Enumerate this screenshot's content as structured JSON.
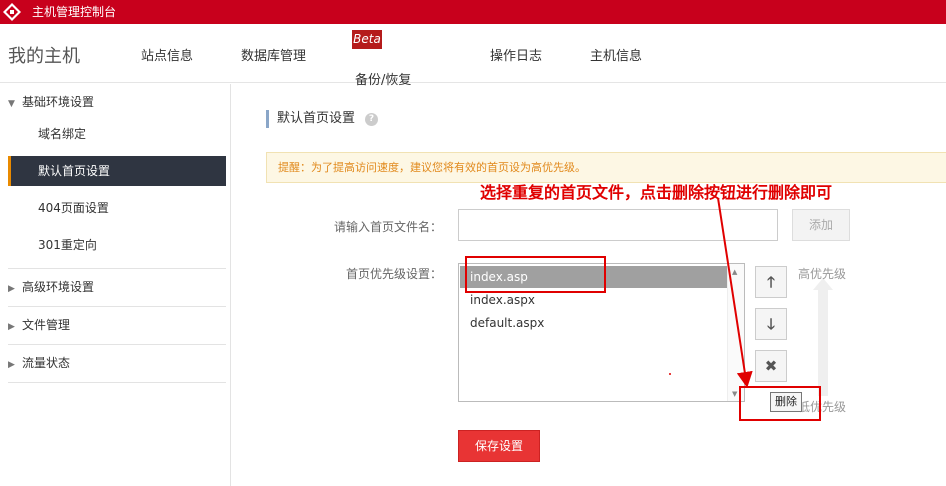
{
  "topbar": {
    "title": "主机管理控制台",
    "logo_icon": "logo-icon",
    "brand_color": "#c8001c"
  },
  "nav": {
    "brand": "我的主机",
    "items": [
      {
        "label": "站点信息"
      },
      {
        "label": "数据库管理"
      },
      {
        "label": "备份/恢复",
        "badge": "Beta"
      },
      {
        "label": "操作日志"
      },
      {
        "label": "主机信息"
      }
    ]
  },
  "sidebar": {
    "sections": [
      {
        "label": "基础环境设置",
        "expanded": true,
        "items": [
          {
            "label": "域名绑定"
          },
          {
            "label": "默认首页设置",
            "active": true
          },
          {
            "label": "404页面设置"
          },
          {
            "label": "301重定向"
          }
        ]
      },
      {
        "label": "高级环境设置",
        "expanded": false
      },
      {
        "label": "文件管理",
        "expanded": false
      },
      {
        "label": "流量状态",
        "expanded": false
      }
    ]
  },
  "main": {
    "title": "默认首页设置",
    "help_icon": "question-icon",
    "tip": "提醒：为了提高访问速度，建议您将有效的首页设为高优先级。",
    "filename_label": "请输入首页文件名：",
    "filename_value": "",
    "add_button": "添加",
    "priority_label": "首页优先级设置：",
    "files": [
      {
        "name": "index.asp",
        "selected": true
      },
      {
        "name": "index.aspx",
        "selected": false
      },
      {
        "name": "default.aspx",
        "selected": false
      }
    ],
    "buttons": {
      "up_icon": "arrow-up-icon",
      "down_icon": "arrow-down-icon",
      "delete_icon": "close-icon"
    },
    "high_priority": "高优先级",
    "low_priority": "低优先级",
    "delete_tooltip": "删除",
    "save_button": "保存设置"
  },
  "annotation": {
    "text": "选择重复的首页文件，点击删除按钮进行删除即可",
    "color": "#e00000"
  }
}
